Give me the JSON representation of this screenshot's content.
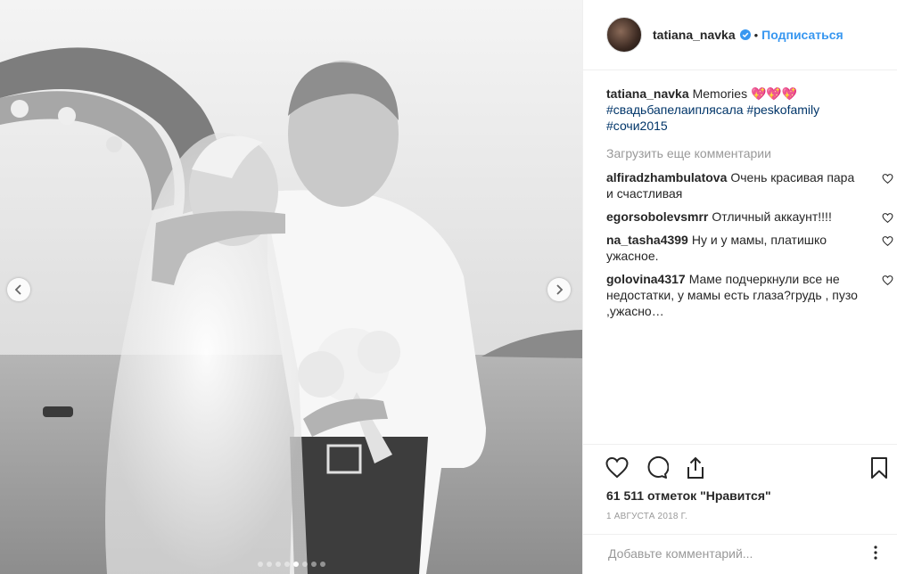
{
  "post": {
    "image_alt": "black and white wedding photo"
  },
  "header": {
    "username": "tatiana_navka",
    "follow_label": "Подписаться",
    "separator": "•"
  },
  "caption": {
    "username": "tatiana_navka",
    "text": "Memories 💖💖💖",
    "hashtags": [
      "#свадьбапелаиплясала",
      "#peskofamily",
      "#сочи2015"
    ]
  },
  "load_more_label": "Загрузить еще комментарии",
  "comments": [
    {
      "username": "alfiradzhambulatova",
      "text": "Очень красивая пара и счастливая"
    },
    {
      "username": "egorsobolevsmrr",
      "text": "Отличный аккаунт!!!!"
    },
    {
      "username": "na_tasha4399",
      "text": "Ну и у мамы, платишко ужасное."
    },
    {
      "username": "golovina4317",
      "text": "Маме подчеркнули все не недостатки, у мамы есть глаза?грудь , пузо ,ужасно…"
    }
  ],
  "likes": "61 511 отметок \"Нравится\"",
  "date": "1 АВГУСТА 2018 Г.",
  "comment_input": {
    "placeholder": "Добавьте комментарий..."
  },
  "carousel": {
    "total_slides": 8,
    "active_slide": 5
  },
  "colors": {
    "link_blue": "#3897f0",
    "hashtag": "#003569",
    "muted": "#999999",
    "border": "#efefef"
  },
  "icons": [
    "chevron-left-icon",
    "chevron-right-icon",
    "verified-icon",
    "heart-icon",
    "comment-icon",
    "share-icon",
    "bookmark-icon",
    "more-icon"
  ]
}
